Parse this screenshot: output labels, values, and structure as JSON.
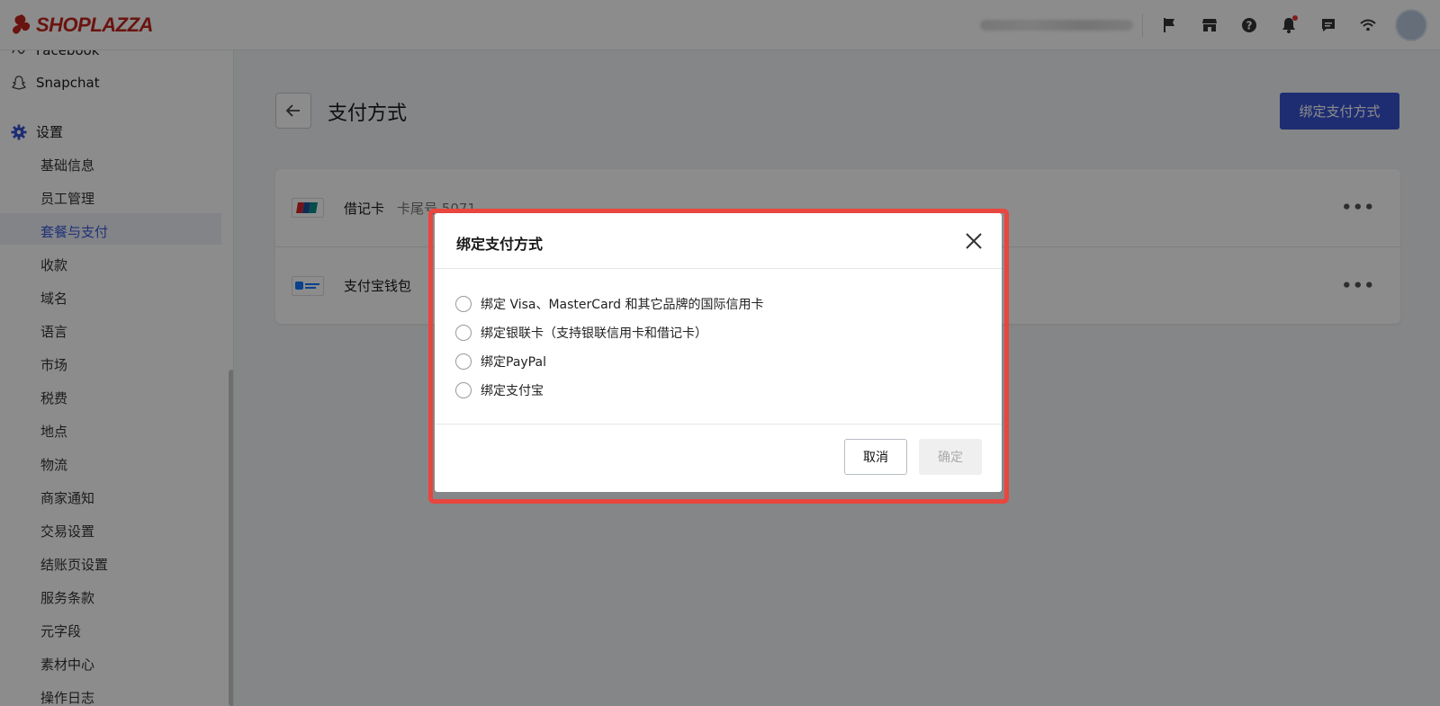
{
  "brand": {
    "name": "SHOPLAZZA",
    "color": "#c0251e"
  },
  "topbar": {
    "icons": [
      "flag-icon",
      "store-icon",
      "help-icon",
      "notification-icon",
      "chat-icon",
      "wifi-icon"
    ]
  },
  "sidebar": {
    "channels": [
      {
        "label": "Facebook",
        "icon": "facebook-icon"
      },
      {
        "label": "Snapchat",
        "icon": "snapchat-icon"
      }
    ],
    "settings": {
      "label": "设置",
      "icon": "gear-icon",
      "items": [
        "基础信息",
        "员工管理",
        "套餐与支付",
        "收款",
        "域名",
        "语言",
        "市场",
        "税费",
        "地点",
        "物流",
        "商家通知",
        "交易设置",
        "结账页设置",
        "服务条款",
        "元字段",
        "素材中心",
        "操作日志"
      ],
      "active": "套餐与支付"
    }
  },
  "main": {
    "title": "支付方式",
    "bind_button": "绑定支付方式",
    "payment_methods": [
      {
        "name": "借记卡",
        "tail": "卡尾号 5071",
        "icon": "unionpay-icon"
      },
      {
        "name": "支付宝钱包",
        "tail": "",
        "icon": "alipay-icon"
      }
    ]
  },
  "dialog": {
    "title": "绑定支付方式",
    "options": [
      "绑定 Visa、MasterCard 和其它品牌的国际信用卡",
      "绑定银联卡（支持银联信用卡和借记卡）",
      "绑定PayPal",
      "绑定支付宝"
    ],
    "cancel": "取消",
    "confirm": "确定"
  },
  "colors": {
    "accent": "#3753d0",
    "highlight": "#e8463f",
    "active_nav": "#3b5bdb"
  }
}
